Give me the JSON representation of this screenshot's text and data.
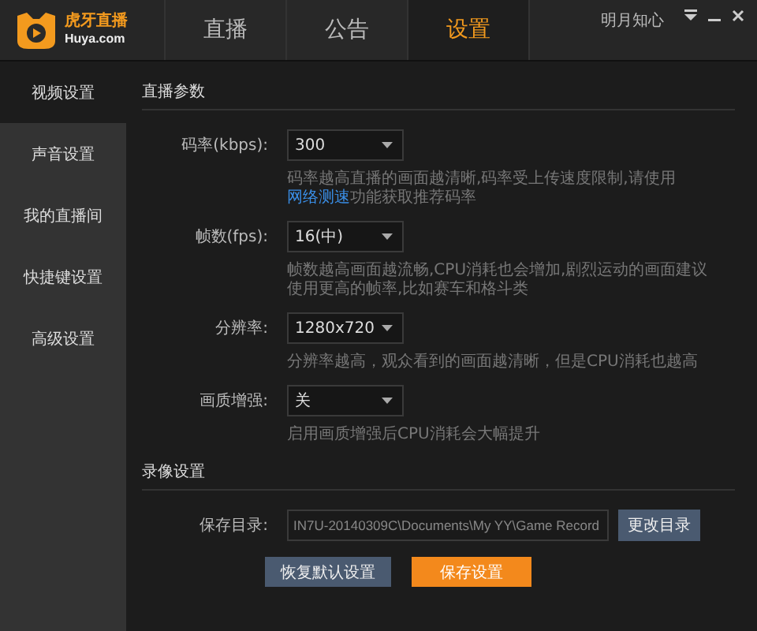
{
  "logo": {
    "title": "虎牙直播",
    "domain": "Huya.com"
  },
  "tabs": [
    {
      "label": "直播",
      "selected": false
    },
    {
      "label": "公告",
      "selected": false
    },
    {
      "label": "设置",
      "selected": true
    }
  ],
  "user": "明月知心",
  "sidebar": {
    "items": [
      {
        "label": "视频设置",
        "selected": true
      },
      {
        "label": "声音设置",
        "selected": false
      },
      {
        "label": "我的直播间",
        "selected": false
      },
      {
        "label": "快捷键设置",
        "selected": false
      },
      {
        "label": "高级设置",
        "selected": false
      }
    ]
  },
  "live_section": {
    "title": "直播参数",
    "rows": [
      {
        "label": "码率(kbps):",
        "value": "300",
        "hint": "码率越高直播的画面越清晰,码率受上传速度限制,请使用",
        "link": "网络测速",
        "hint_after": "功能获取推荐码率"
      },
      {
        "label": "帧数(fps):",
        "value": "16(中)",
        "hint": "帧数越高画面越流畅,CPU消耗也会增加,剧烈运动的画面建议使用更高的帧率,比如赛车和格斗类"
      },
      {
        "label": "分辨率:",
        "value": "1280x720",
        "hint": "分辨率越高，观众看到的画面越清晰，但是CPU消耗也越高"
      },
      {
        "label": "画质增强:",
        "value": "关",
        "hint": "启用画质增强后CPU消耗会大幅提升"
      }
    ]
  },
  "record_section": {
    "title": "录像设置",
    "label": "保存目录:",
    "path": "IN7U-20140309C\\Documents\\My YY\\Game Record",
    "change_button": "更改目录"
  },
  "buttons": [
    {
      "label": "恢复默认设置",
      "kind": "secondary"
    },
    {
      "label": "保存设置",
      "kind": "primary"
    }
  ]
}
